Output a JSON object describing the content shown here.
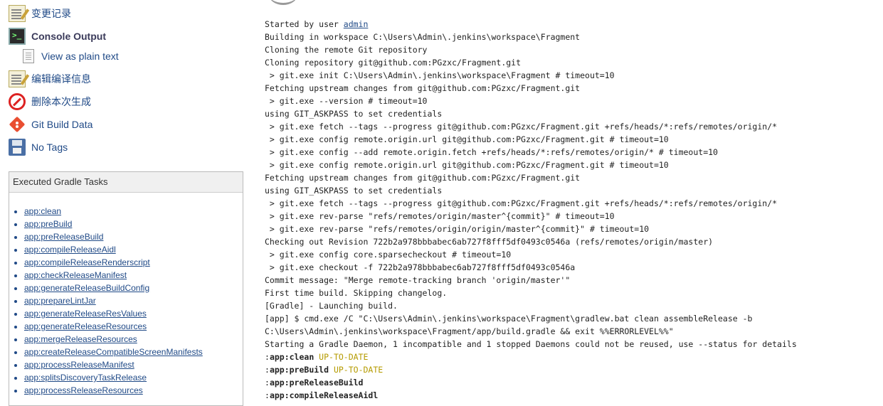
{
  "sidebar": {
    "changes": "变更记录",
    "console_output": "Console Output",
    "view_plain_text": "View as plain text",
    "edit_build_info": "编辑编译信息",
    "delete_build": "删除本次生成",
    "git_build_data": "Git Build Data",
    "no_tags": "No Tags"
  },
  "gradle_panel": {
    "title": "Executed Gradle Tasks",
    "tasks": [
      "app:clean",
      "app:preBuild",
      "app:preReleaseBuild",
      "app:compileReleaseAidl",
      "app:compileReleaseRenderscript",
      "app:checkReleaseManifest",
      "app:generateReleaseBuildConfig",
      "app:prepareLintJar",
      "app:generateReleaseResValues",
      "app:generateReleaseResources",
      "app:mergeReleaseResources",
      "app:createReleaseCompatibleScreenManifests",
      "app:processReleaseManifest",
      "app:splitsDiscoveryTaskRelease",
      "app:processReleaseResources"
    ]
  },
  "console": {
    "started_prefix": "Started by user ",
    "started_user": "admin",
    "lines": [
      "Building in workspace C:\\Users\\Admin\\.jenkins\\workspace\\Fragment",
      "Cloning the remote Git repository",
      "Cloning repository git@github.com:PGzxc/Fragment.git",
      " > git.exe init C:\\Users\\Admin\\.jenkins\\workspace\\Fragment # timeout=10",
      "Fetching upstream changes from git@github.com:PGzxc/Fragment.git",
      " > git.exe --version # timeout=10",
      "using GIT_ASKPASS to set credentials",
      " > git.exe fetch --tags --progress git@github.com:PGzxc/Fragment.git +refs/heads/*:refs/remotes/origin/*",
      " > git.exe config remote.origin.url git@github.com:PGzxc/Fragment.git # timeout=10",
      " > git.exe config --add remote.origin.fetch +refs/heads/*:refs/remotes/origin/* # timeout=10",
      " > git.exe config remote.origin.url git@github.com:PGzxc/Fragment.git # timeout=10",
      "Fetching upstream changes from git@github.com:PGzxc/Fragment.git",
      "using GIT_ASKPASS to set credentials",
      " > git.exe fetch --tags --progress git@github.com:PGzxc/Fragment.git +refs/heads/*:refs/remotes/origin/*",
      " > git.exe rev-parse \"refs/remotes/origin/master^{commit}\" # timeout=10",
      " > git.exe rev-parse \"refs/remotes/origin/origin/master^{commit}\" # timeout=10",
      "Checking out Revision 722b2a978bbbabec6ab727f8fff5df0493c0546a (refs/remotes/origin/master)",
      " > git.exe config core.sparsecheckout # timeout=10",
      " > git.exe checkout -f 722b2a978bbbabec6ab727f8fff5df0493c0546a",
      "Commit message: \"Merge remote-tracking branch 'origin/master'\"",
      "First time build. Skipping changelog.",
      "[Gradle] - Launching build.",
      "[app] $ cmd.exe /C \"C:\\Users\\Admin\\.jenkins\\workspace\\Fragment\\gradlew.bat clean assembleRelease -b",
      "C:\\Users\\Admin\\.jenkins\\workspace\\Fragment/app/build.gradle && exit %%ERRORLEVEL%%\"",
      "Starting a Gradle Daemon, 1 incompatible and 1 stopped Daemons could not be reused, use --status for details"
    ],
    "gradle_lines": [
      {
        "colon": ":",
        "task": "app:clean",
        "status": " UP-TO-DATE"
      },
      {
        "colon": ":",
        "task": "app:preBuild",
        "status": " UP-TO-DATE"
      },
      {
        "colon": ":",
        "task": "app:preReleaseBuild",
        "status": ""
      },
      {
        "colon": ":",
        "task": "app:compileReleaseAidl",
        "status": ""
      }
    ]
  }
}
